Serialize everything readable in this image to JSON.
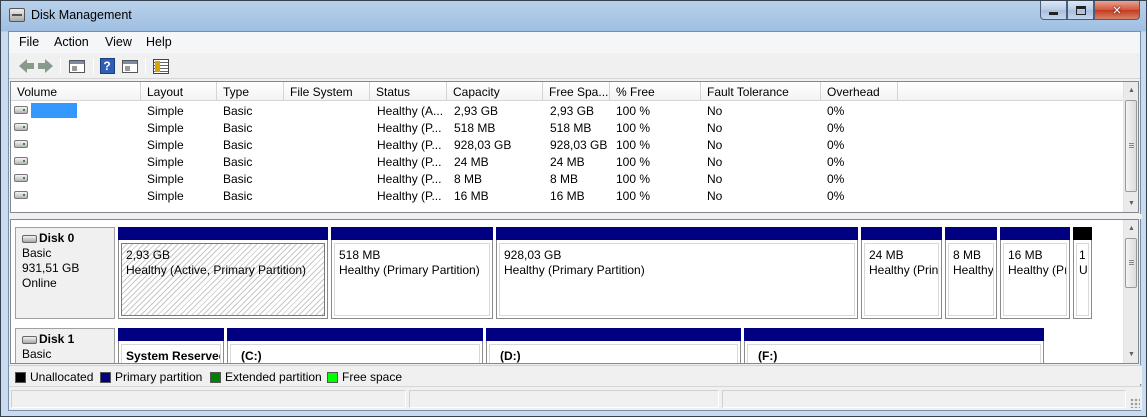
{
  "window": {
    "title": "Disk Management"
  },
  "menu": [
    "File",
    "Action",
    "View",
    "Help"
  ],
  "toolbar": {
    "help_label": "?"
  },
  "volume_list": {
    "columns": [
      "Volume",
      "Layout",
      "Type",
      "File System",
      "Status",
      "Capacity",
      "Free Spa...",
      "% Free",
      "Fault Tolerance",
      "Overhead"
    ],
    "rows": [
      {
        "volume": "",
        "layout": "Simple",
        "type": "Basic",
        "fs": "",
        "status": "Healthy (A...",
        "capacity": "2,93 GB",
        "free": "2,93 GB",
        "pct": "100 %",
        "fault": "No",
        "overhead": "0%"
      },
      {
        "volume": "",
        "layout": "Simple",
        "type": "Basic",
        "fs": "",
        "status": "Healthy (P...",
        "capacity": "518 MB",
        "free": "518 MB",
        "pct": "100 %",
        "fault": "No",
        "overhead": "0%"
      },
      {
        "volume": "",
        "layout": "Simple",
        "type": "Basic",
        "fs": "",
        "status": "Healthy (P...",
        "capacity": "928,03 GB",
        "free": "928,03 GB",
        "pct": "100 %",
        "fault": "No",
        "overhead": "0%"
      },
      {
        "volume": "",
        "layout": "Simple",
        "type": "Basic",
        "fs": "",
        "status": "Healthy (P...",
        "capacity": "24 MB",
        "free": "24 MB",
        "pct": "100 %",
        "fault": "No",
        "overhead": "0%"
      },
      {
        "volume": "",
        "layout": "Simple",
        "type": "Basic",
        "fs": "",
        "status": "Healthy (P...",
        "capacity": "8 MB",
        "free": "8 MB",
        "pct": "100 %",
        "fault": "No",
        "overhead": "0%"
      },
      {
        "volume": "",
        "layout": "Simple",
        "type": "Basic",
        "fs": "",
        "status": "Healthy (P...",
        "capacity": "16 MB",
        "free": "16 MB",
        "pct": "100 %",
        "fault": "No",
        "overhead": "0%"
      }
    ]
  },
  "disks": [
    {
      "name": "Disk 0",
      "type": "Basic",
      "size": "931,51 GB",
      "state": "Online",
      "partitions": [
        {
          "size": "2,93 GB",
          "status": "Healthy (Active, Primary Partition)"
        },
        {
          "size": "518 MB",
          "status": "Healthy (Primary Partition)"
        },
        {
          "size": "928,03 GB",
          "status": "Healthy (Primary Partition)"
        },
        {
          "size": "24 MB",
          "status": "Healthy (Prin"
        },
        {
          "size": "8 MB",
          "status": "Healthy"
        },
        {
          "size": "16 MB",
          "status": "Healthy (Pı"
        },
        {
          "size": "1",
          "status": "U"
        }
      ]
    },
    {
      "name": "Disk 1",
      "type": "Basic",
      "partitions": [
        {
          "label": "System Reserved"
        },
        {
          "label": "(C:)"
        },
        {
          "label": "(D:)"
        },
        {
          "label": "(F:)"
        }
      ]
    }
  ],
  "legend": [
    {
      "label": "Unallocated",
      "color": "#000000"
    },
    {
      "label": "Primary partition",
      "color": "#000080"
    },
    {
      "label": "Extended partition",
      "color": "#008000"
    },
    {
      "label": "Free space",
      "color": "#00ff00"
    }
  ]
}
